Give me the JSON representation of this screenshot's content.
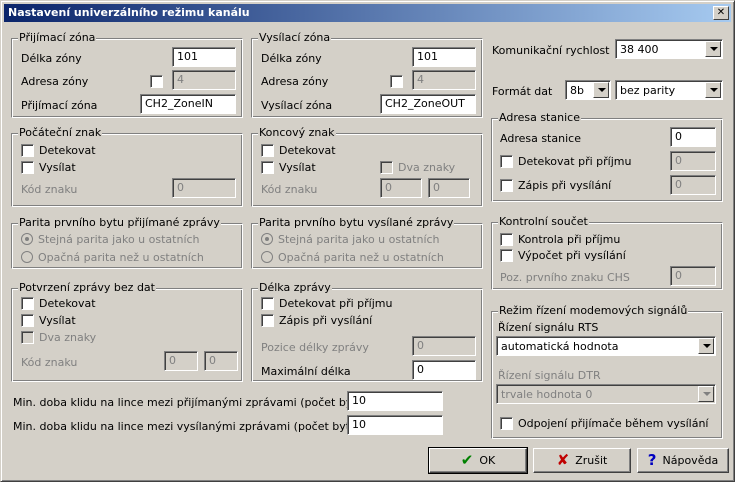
{
  "window": {
    "title": "Nastavení univerzálního režimu kanálu",
    "close_glyph": "✕"
  },
  "receive_zone": {
    "legend": "Přijímací zóna",
    "length_label": "Délka zóny",
    "length_value": "101",
    "address_label": "Adresa zóny",
    "address_value": "4",
    "zone_label": "Přijímací zóna",
    "zone_value": "CH2_ZoneIN"
  },
  "send_zone": {
    "legend": "Vysílací zóna",
    "length_label": "Délka zóny",
    "length_value": "101",
    "address_label": "Adresa zóny",
    "address_value": "4",
    "zone_label": "Vysílací zóna",
    "zone_value": "CH2_ZoneOUT"
  },
  "start_char": {
    "legend": "Počáteční znak",
    "detect_label": "Detekovat",
    "send_label": "Vysílat",
    "code_label": "Kód znaku",
    "code_value": "0"
  },
  "end_char": {
    "legend": "Koncový znak",
    "detect_label": "Detekovat",
    "send_label": "Vysílat",
    "two_chars_label": "Dva znaky",
    "code_label": "Kód znaku",
    "code_value1": "0",
    "code_value2": "0"
  },
  "parity_rx": {
    "legend": "Parita prvního bytu přijímané zprávy",
    "opt_same": "Stejná parita jako u ostatních",
    "opt_diff": "Opačná parita než u ostatních"
  },
  "parity_tx": {
    "legend": "Parita prvního bytu vysílané zprávy",
    "opt_same": "Stejná parita jako u ostatních",
    "opt_diff": "Opačná parita než u ostatních"
  },
  "ack_nodata": {
    "legend": "Potvrzení zprávy bez dat",
    "detect_label": "Detekovat",
    "send_label": "Vysílat",
    "two_chars_label": "Dva znaky",
    "code_label": "Kód znaku",
    "code_value1": "0",
    "code_value2": "0"
  },
  "msg_length": {
    "legend": "Délka zprávy",
    "detect_rx_label": "Detekovat při příjmu",
    "write_tx_label": "Zápis při vysílání",
    "pos_label": "Pozice délky zprávy",
    "pos_value": "0",
    "max_label": "Maximální délka",
    "max_value": "0"
  },
  "idle": {
    "rx_label": "Min. doba klidu na lince mezi přijímanými zprávami (počet bytů)",
    "rx_value": "10",
    "tx_label": "Min. doba klidu na lince mezi vysílanými zprávami (počet bytů)",
    "tx_value": "10"
  },
  "comm": {
    "speed_label": "Komunikační rychlost",
    "speed_value": "38 400",
    "format_label": "Formát dat",
    "bits_value": "8b",
    "parity_value": "bez parity"
  },
  "station": {
    "legend": "Adresa stanice",
    "addr_label": "Adresa stanice",
    "addr_value": "0",
    "detect_rx_label": "Detekovat při příjmu",
    "detect_rx_value": "0",
    "write_tx_label": "Zápis při vysílání",
    "write_tx_value": "0"
  },
  "checksum": {
    "legend": "Kontrolní součet",
    "check_rx_label": "Kontrola při příjmu",
    "calc_tx_label": "Výpočet při vysílání",
    "pos_label": "Poz. prvního znaku CHS",
    "pos_value": "0"
  },
  "modem": {
    "legend": "Režim řízení modemových signálů",
    "rts_label": "Řízení signálu RTS",
    "rts_value": "automatická hodnota",
    "dtr_label": "Řízení signálu DTR",
    "dtr_value": "trvale hodnota 0",
    "disconnect_label": "Odpojení přijímače během vysílání"
  },
  "buttons": {
    "ok": "OK",
    "cancel": "Zrušit",
    "help": "Nápověda"
  },
  "colors": {
    "face": "#d4d0c8",
    "title_start": "#0a246a",
    "title_end": "#a6caf0",
    "ok_icon": "#008000",
    "cancel_icon": "#c00000",
    "help_icon": "#0000c0"
  },
  "icons": {
    "ok": "check-icon",
    "cancel": "x-icon",
    "help": "question-icon"
  }
}
